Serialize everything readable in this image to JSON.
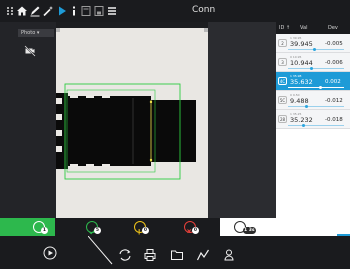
{
  "app": {
    "title": "Conn"
  },
  "toolbar": {
    "icons": [
      "grip-icon",
      "home-icon",
      "pen-icon",
      "wand-icon",
      "play-icon",
      "info-icon",
      "file-icon",
      "save-icon",
      "menu-icon"
    ]
  },
  "camera": {
    "mode_label": "Photo ▾"
  },
  "measurements": {
    "headers": {
      "id": "ID ↑",
      "value": "Val",
      "dev": "Dev"
    },
    "rows": [
      {
        "id": "2",
        "nominal": "1 39.95",
        "value": "39.945",
        "dev": "-0.005",
        "gauge": 0.45,
        "selected": false
      },
      {
        "id": "3",
        "nominal": "0 10.95",
        "value": "10.944",
        "dev": "-0.006",
        "gauge": 0.4,
        "selected": false
      },
      {
        "id": "4C",
        "nominal": "1 35.98",
        "value": "35.632",
        "dev": "0.002",
        "gauge": 0.55,
        "selected": true
      },
      {
        "id": "5C",
        "nominal": "0 9.50",
        "value": "9.488",
        "dev": "-0.012",
        "gauge": 0.3,
        "selected": false
      },
      {
        "id": "28",
        "nominal": "1 35.25",
        "value": "35.232",
        "dev": "-0.018",
        "gauge": 0.25,
        "selected": false
      }
    ]
  },
  "status": {
    "items": [
      {
        "name": "total",
        "count": "1",
        "color": "#2db84d"
      },
      {
        "name": "pass",
        "count": "5",
        "color": "#2db84d"
      },
      {
        "name": "warning",
        "count": "0",
        "color": "#f0c419"
      },
      {
        "name": "fail",
        "count": "0",
        "color": "#e8403a"
      },
      {
        "name": "camera",
        "count": "1 3s",
        "color": "#ffffff"
      }
    ]
  },
  "nav": {
    "icons": [
      "play-circle-icon",
      "flip-icon",
      "print-icon",
      "folder-icon",
      "chart-icon",
      "user-icon"
    ]
  },
  "colors": {
    "accent": "#1e9bd7",
    "pass": "#2db84d",
    "warning": "#f0c419",
    "fail": "#e8403a",
    "roi": "#2ecc40"
  }
}
